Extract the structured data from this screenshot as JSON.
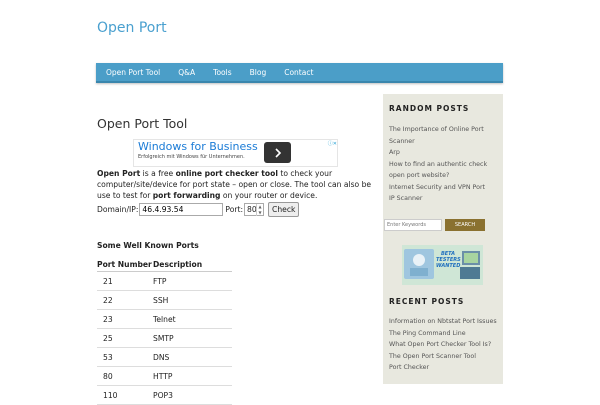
{
  "site": {
    "title": "Open Port"
  },
  "nav": {
    "items": [
      "Open Port Tool",
      "Q&A",
      "Tools",
      "Blog",
      "Contact"
    ]
  },
  "page": {
    "title": "Open Port Tool"
  },
  "ad": {
    "headline": "Windows for Business",
    "subtext": "Erfolgreich mit Windows für Unternehmen.",
    "button_icon": "chevron-right-icon",
    "corner": "ⓘ✕"
  },
  "intro": {
    "p1_bold": "Open Port",
    "p1": " is a free ",
    "p2_bold": "online port checker tool",
    "p2": " to check your computer/site/device for port state – open or close. The tool can also be use to test for ",
    "p3_bold": "port forwarding",
    "p3": " on your router or device."
  },
  "form": {
    "domain_label": "Domain/IP:",
    "domain_value": "46.4.93.54",
    "port_label": "Port:",
    "port_value": "80",
    "check_label": "Check"
  },
  "ports": {
    "heading": "Some Well Known Ports",
    "columns": [
      "Port Number",
      "Description"
    ],
    "rows": [
      [
        "21",
        "FTP"
      ],
      [
        "22",
        "SSH"
      ],
      [
        "23",
        "Telnet"
      ],
      [
        "25",
        "SMTP"
      ],
      [
        "53",
        "DNS"
      ],
      [
        "80",
        "HTTP"
      ],
      [
        "110",
        "POP3"
      ]
    ]
  },
  "sidebar": {
    "random_heading": "RANDOM POSTS",
    "random_posts": [
      "The Importance of Online Port Scanner",
      "Arp",
      "How to find an authentic check open port website?",
      "Internet Security and VPN Port IP Scanner"
    ],
    "search_placeholder": "Enter Keywords",
    "search_button": "SEARCH",
    "beta_text": "BETA TESTERS WANTED",
    "recent_heading": "RECENT POSTS",
    "recent_posts": [
      "Information on Nbtstat Port Issues",
      "The Ping Command Line",
      "What Open Port Checker Tool Is?",
      "The Open Port Scanner Tool",
      "Port Checker"
    ]
  },
  "colors": {
    "nav_bg": "#4b9ec8",
    "title_color": "#4aa0cf",
    "sidebar_bg": "#e8e8df",
    "search_button_bg": "#8a7130"
  }
}
